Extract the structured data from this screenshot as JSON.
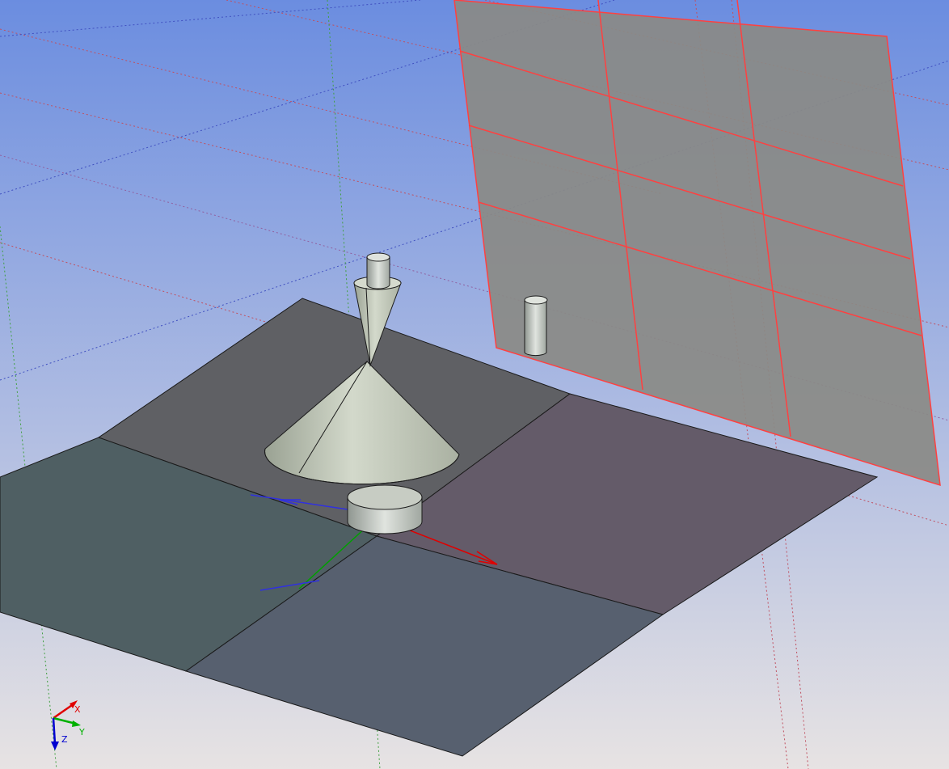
{
  "viewport": {
    "background_top": "#6b8de0",
    "background_bottom": "#e7e3e3"
  },
  "colors": {
    "grid_red": "#e05050",
    "grid_green": "#40b040",
    "grid_blue": "#3040c0",
    "ground_plane": "#3b4a55",
    "solid_fill": "#c9cfc0",
    "solid_edge": "#1c1c1c",
    "selected_edge": "#ff4040",
    "axis_x": "#e00000",
    "axis_y": "#00a000",
    "axis_z": "#0000d0"
  },
  "axis_triad": {
    "x_label": "X",
    "y_label": "Y",
    "z_label": "Z",
    "x_icon": "axis-x-arrow-icon",
    "y_icon": "axis-y-arrow-icon",
    "z_icon": "axis-z-arrow-icon"
  }
}
